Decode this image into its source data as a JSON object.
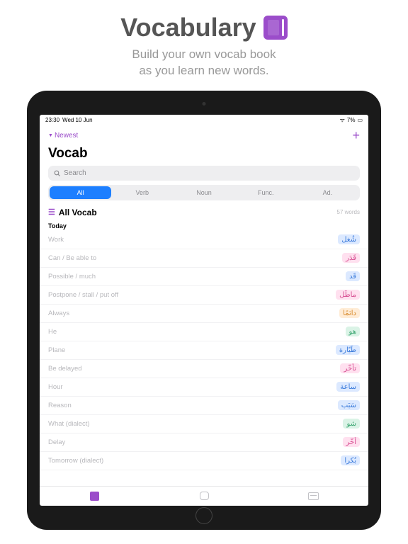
{
  "hero": {
    "title": "Vocabulary",
    "line1": "Build your own vocab book",
    "line2": "as you learn new words."
  },
  "status": {
    "time": "23:30",
    "date": "Wed 10 Jun",
    "battery": "7%"
  },
  "nav": {
    "sort_label": "Newest",
    "add_label": "+"
  },
  "app": {
    "title": "Vocab",
    "search_placeholder": "Search"
  },
  "tabs": [
    "All",
    "Verb",
    "Noun",
    "Func.",
    "Ad."
  ],
  "section": {
    "title": "All Vocab",
    "count": "57 words"
  },
  "group_label": "Today",
  "words": [
    {
      "en": "Work",
      "ar": "شُغل",
      "tag": "blue"
    },
    {
      "en": "Can / Be able to",
      "ar": "قَدَر",
      "tag": "pink"
    },
    {
      "en": "Possible / much",
      "ar": "قَد",
      "tag": "blue"
    },
    {
      "en": "Postpone / stall / put off",
      "ar": "ماطَل",
      "tag": "pink"
    },
    {
      "en": "Always",
      "ar": "دائمًا",
      "tag": "orange"
    },
    {
      "en": "He",
      "ar": "هو",
      "tag": "green"
    },
    {
      "en": "Plane",
      "ar": "طَيّارة",
      "tag": "blue"
    },
    {
      "en": "Be delayed",
      "ar": "تأخّر",
      "tag": "pink"
    },
    {
      "en": "Hour",
      "ar": "ساعة",
      "tag": "blue"
    },
    {
      "en": "Reason",
      "ar": "سَبَب",
      "tag": "blue"
    },
    {
      "en": "What (dialect)",
      "ar": "شو",
      "tag": "green"
    },
    {
      "en": "Delay",
      "ar": "أخّر",
      "tag": "pink"
    },
    {
      "en": "Tomorrow (dialect)",
      "ar": "بُكرا",
      "tag": "blue"
    }
  ]
}
